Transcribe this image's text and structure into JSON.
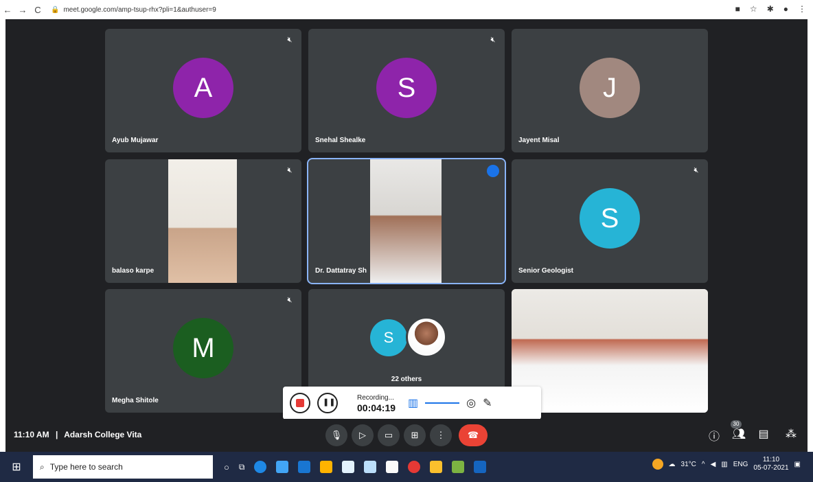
{
  "browser": {
    "url": "meet.google.com/amp-tsup-rhx?pli=1&authuser=9",
    "nav": {
      "back": "←",
      "forward": "→",
      "reload": "C"
    }
  },
  "tiles": [
    {
      "name": "Ayub Mujawar",
      "initial": "A",
      "avatar_color": "#8e24aa",
      "muted": true
    },
    {
      "name": "Snehal Shealke",
      "initial": "S",
      "avatar_color": "#8e24aa",
      "muted": true
    },
    {
      "name": "Jayent Misal",
      "initial": "J",
      "avatar_color": "#a1887f",
      "muted": false
    },
    {
      "name": "balaso karpe",
      "muted": true
    },
    {
      "name": "Dr. Dattatray Sh",
      "speaking": true
    },
    {
      "name": "Senior Geologist",
      "initial": "S",
      "avatar_color": "#26b4d6",
      "muted": true
    },
    {
      "name": "Megha Shitole",
      "initial": "M",
      "avatar_color": "#1b5e20",
      "muted": true
    },
    {
      "others_label": "22 others",
      "initial": "S",
      "avatar_color": "#26b4d6"
    },
    {
      "name": ""
    }
  ],
  "recording": {
    "status": "Recording...",
    "time": "00:04:19"
  },
  "meeting": {
    "time": "11:10 AM",
    "separator": "|",
    "title": "Adarsh College Vita",
    "people_count": "30"
  },
  "taskbar": {
    "search_placeholder": "Type here to search",
    "weather": "31°C",
    "lang": "ENG",
    "clock_time": "11:10",
    "clock_date": "05-07-2021"
  }
}
